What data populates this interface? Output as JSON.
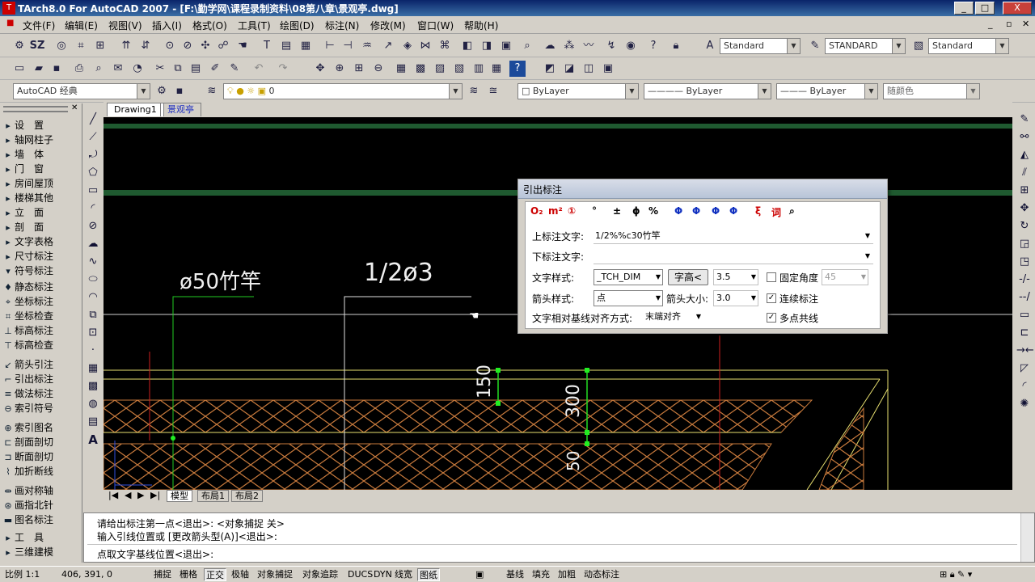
{
  "window": {
    "title": "TArch8.0 For AutoCAD 2007 - [F:\\勤学网\\课程录制资料\\08第八章\\景观亭.dwg]",
    "minimize": "_",
    "maximize": "□",
    "close": "X"
  },
  "menu": [
    "文件(F)",
    "编辑(E)",
    "视图(V)",
    "插入(I)",
    "格式(O)",
    "工具(T)",
    "绘图(D)",
    "标注(N)",
    "修改(M)",
    "窗口(W)",
    "帮助(H)"
  ],
  "toolbar1": {
    "sz_label": "SZ",
    "text_style": "Standard",
    "dim_style": "STANDARD",
    "table_style": "Standard"
  },
  "toolbar3": {
    "workspace": "AutoCAD 经典",
    "layer": "0",
    "color": "ByLayer",
    "linetype": "ByLayer",
    "lineweight": "ByLayer",
    "plotstyle": "随颜色"
  },
  "left_panel": {
    "items": [
      {
        "label": "设　置",
        "icon": "triangle-right"
      },
      {
        "label": "轴网柱子",
        "icon": "triangle-right"
      },
      {
        "label": "墙　体",
        "icon": "triangle-right"
      },
      {
        "label": "门　窗",
        "icon": "triangle-right"
      },
      {
        "label": "房间屋顶",
        "icon": "triangle-right"
      },
      {
        "label": "楼梯其他",
        "icon": "triangle-right"
      },
      {
        "label": "立　面",
        "icon": "triangle-right"
      },
      {
        "label": "剖　面",
        "icon": "triangle-right"
      },
      {
        "label": "文字表格",
        "icon": "triangle-right"
      },
      {
        "label": "尺寸标注",
        "icon": "triangle-right"
      },
      {
        "label": "符号标注",
        "icon": "triangle-down"
      },
      {
        "label": "静态标注",
        "icon": "static-dim"
      },
      {
        "label": "坐标标注",
        "icon": "coord-dim"
      },
      {
        "label": "坐标检查",
        "icon": "coord-check"
      },
      {
        "label": "标高标注",
        "icon": "elevation-dim"
      },
      {
        "label": "标高检查",
        "icon": "elevation-check"
      },
      {
        "label": "箭头引注",
        "icon": "arrow-leader"
      },
      {
        "label": "引出标注",
        "icon": "leader-dim"
      },
      {
        "label": "做法标注",
        "icon": "method-dim"
      },
      {
        "label": "索引符号",
        "icon": "index-symbol"
      },
      {
        "label": "索引图名",
        "icon": "index-name"
      },
      {
        "label": "剖面剖切",
        "icon": "section-cut"
      },
      {
        "label": "断面剖切",
        "icon": "break-cut"
      },
      {
        "label": "加折断线",
        "icon": "break-line"
      },
      {
        "label": "画对称轴",
        "icon": "symmetry-axis"
      },
      {
        "label": "画指北针",
        "icon": "north-arrow"
      },
      {
        "label": "图名标注",
        "icon": "drawing-name"
      },
      {
        "label": "工　具",
        "icon": "triangle-right"
      },
      {
        "label": "三维建模",
        "icon": "triangle-right"
      }
    ]
  },
  "doc_tabs": [
    "Drawing1",
    "景观亭"
  ],
  "canvas": {
    "label_phi50": "ø50竹竿",
    "label_half": "1/2ø3",
    "dim_150": "150",
    "dim_300": "300",
    "dim_50": "50"
  },
  "layout_tabs": [
    "模型",
    "布局1",
    "布局2"
  ],
  "dialog": {
    "title": "引出标注",
    "symbols": [
      "O₂",
      "m²",
      "①",
      "°",
      "±",
      "ϕ",
      "%",
      "Φ",
      "Φ",
      "Φ",
      "Φ",
      "ξ",
      "词"
    ],
    "upper_text_label": "上标注文字:",
    "upper_text_value": "1/2%%c30竹竿",
    "lower_text_label": "下标注文字:",
    "lower_text_value": "",
    "text_style_label": "文字样式:",
    "text_style_value": "_TCH_DIM",
    "text_height_btn": "字高<",
    "text_height_value": "3.5",
    "fixed_angle_label": "固定角度",
    "fixed_angle_value": "45",
    "arrow_style_label": "箭头样式:",
    "arrow_style_value": "点",
    "arrow_size_label": "箭头大小:",
    "arrow_size_value": "3.0",
    "continuous_label": "连续标注",
    "align_label": "文字相对基线对齐方式:",
    "align_value": "末端对齐",
    "multipoint_label": "多点共线"
  },
  "command": {
    "line1": "请给出标注第一点<退出>:  <对象捕捉 关>",
    "line2": "输入引线位置或 [更改箭头型(A)]<退出>:",
    "line3": "点取文字基线位置<退出>:"
  },
  "status": {
    "scale": "比例 1:1",
    "coords": "406, 391, 0",
    "toggles": [
      "捕捉",
      "栅格",
      "正交",
      "极轴",
      "对象捕捉",
      "对象追踪",
      "DUCS",
      "DYN",
      "线宽",
      "图纸"
    ],
    "extra": [
      "基线",
      "填充",
      "加粗",
      "动态标注"
    ]
  },
  "colors": {
    "canvas_bg": "#000000",
    "hatch": "#c87a3c",
    "green_line": "#2a6a3a",
    "dim_green": "#22dd22",
    "dim_yellow": "#e8e070"
  }
}
